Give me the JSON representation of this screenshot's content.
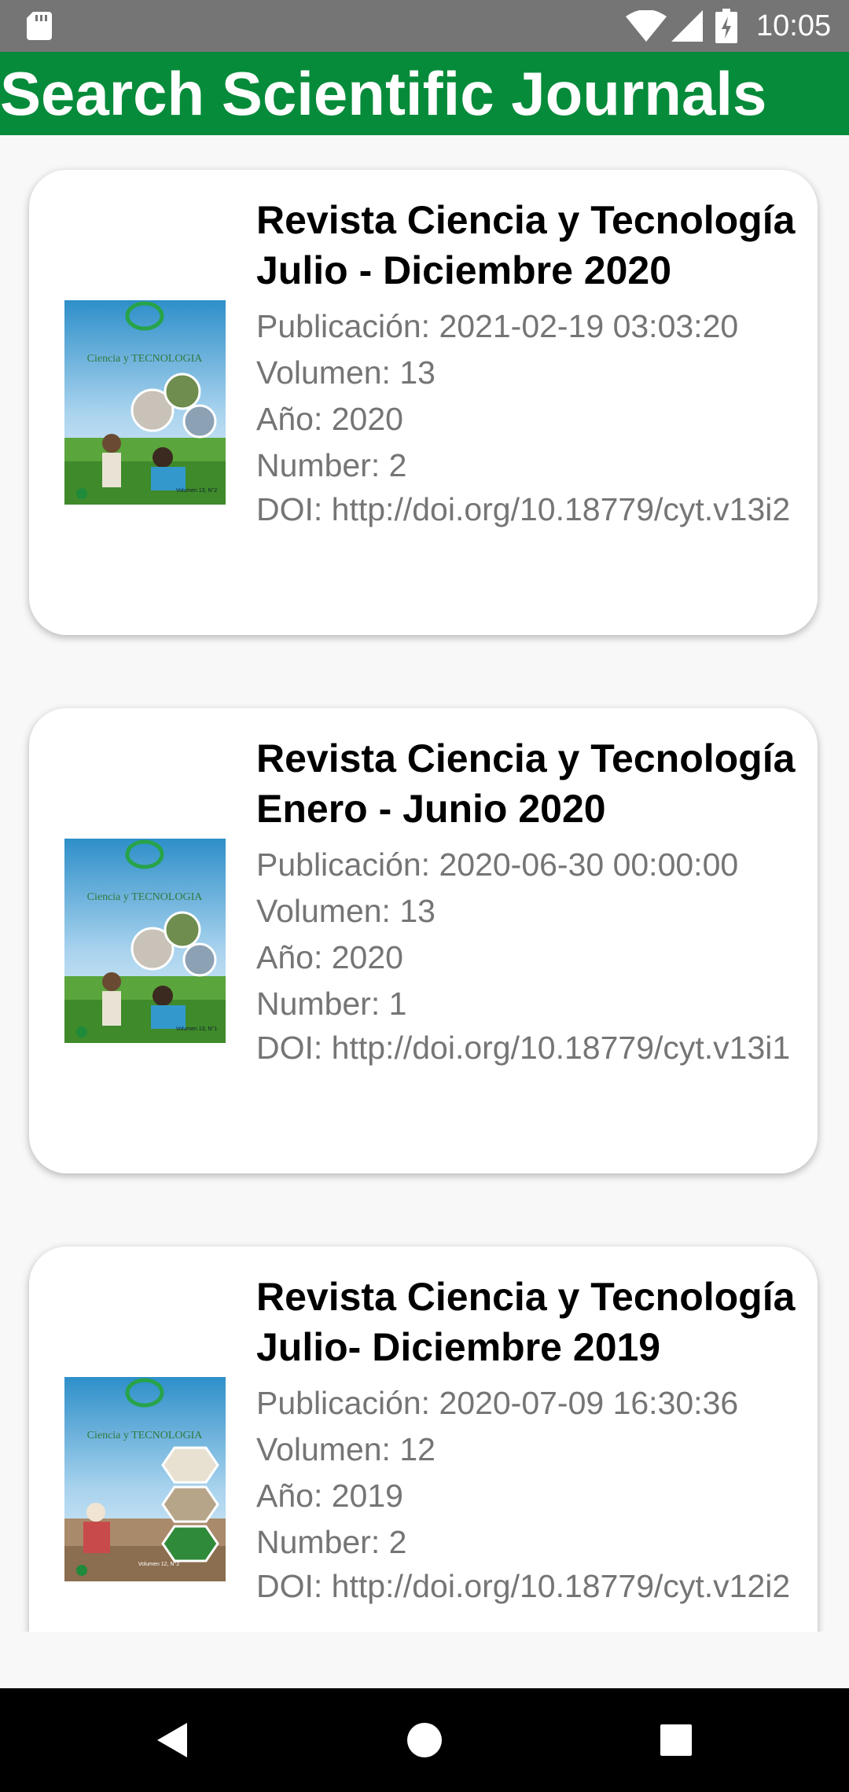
{
  "status_bar": {
    "time": "10:05",
    "icons": [
      "sd-card-icon",
      "wifi-icon",
      "cell-signal-icon",
      "battery-charging-icon"
    ]
  },
  "app_bar": {
    "title": "Search Scientific Journals",
    "color": "#068b3a"
  },
  "journals": [
    {
      "title": "Revista Ciencia y Tecnología Julio - Diciembre 2020",
      "publication": "Publicación: 2021-02-19 03:03:20",
      "volume": "Volumen: 13",
      "year": "Año: 2020",
      "number": "Number: 2",
      "doi": "DOI: http://doi.org/10.18779/cyt.v13i2",
      "cover_text": "Ciencia y TECNOLOGIA",
      "cover_volume": "Volumen 13, N°2"
    },
    {
      "title": "Revista Ciencia y Tecnología Enero - Junio 2020",
      "publication": "Publicación: 2020-06-30 00:00:00",
      "volume": "Volumen: 13",
      "year": "Año: 2020",
      "number": "Number: 1",
      "doi": "DOI: http://doi.org/10.18779/cyt.v13i1",
      "cover_text": "Ciencia y TECNOLOGIA",
      "cover_volume": "Volumen 13, N°1"
    },
    {
      "title": "Revista Ciencia y Tecnología Julio- Diciembre 2019",
      "publication": "Publicación: 2020-07-09 16:30:36",
      "volume": "Volumen: 12",
      "year": "Año: 2019",
      "number": "Number: 2",
      "doi": "DOI: http://doi.org/10.18779/cyt.v12i2",
      "cover_text": "Ciencia y TECNOLOGIA",
      "cover_volume": "Volumen 12, N°2"
    }
  ],
  "nav_bar": {
    "buttons": [
      "back-icon",
      "home-icon",
      "recents-icon"
    ]
  }
}
